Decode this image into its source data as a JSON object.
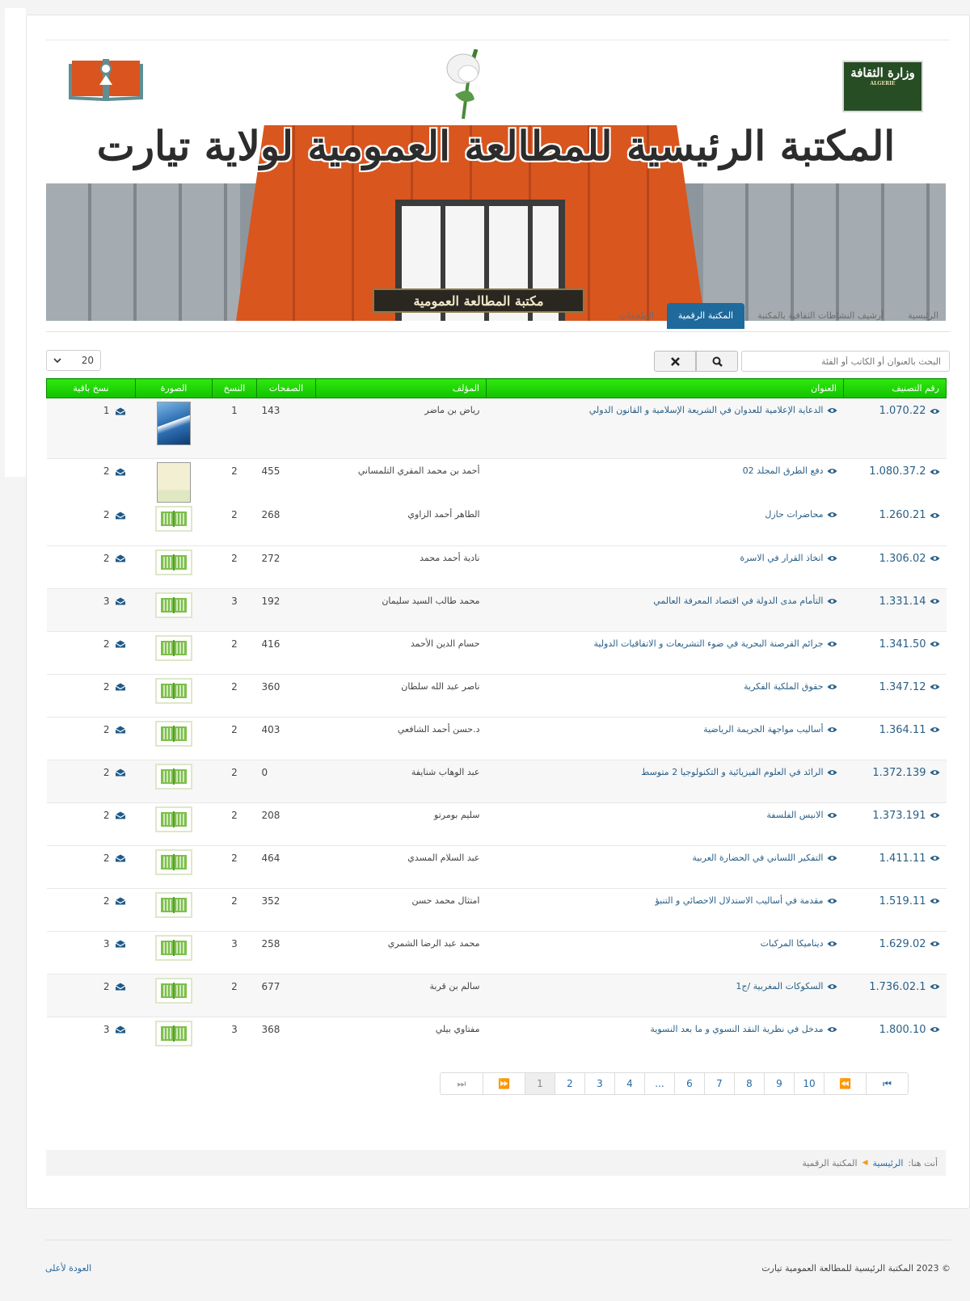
{
  "banner": {
    "title": "المكتبة الرئيسية للمطالعة العمومية لولاية تيارت",
    "sign": "مكتبة المطالعة العمومية",
    "ministry_name": "وزارة الثقافة",
    "ministry_sub": "ALGERIE"
  },
  "nav": {
    "tabs": [
      {
        "label": "الرئيسية",
        "active": false
      },
      {
        "label": "أرشيف النشاطات الثقافية بالمكتبة",
        "active": false
      },
      {
        "label": "المكتبة الرقمية",
        "active": true
      },
      {
        "label": "الملحقات",
        "active": false
      }
    ]
  },
  "search": {
    "placeholder": "البحث بالعنوان أو الكاتب أو الفئة",
    "value": ""
  },
  "page_size": {
    "selected": "20"
  },
  "table": {
    "headers": {
      "code": "رقم التصنيف",
      "title": "العنوان",
      "author": "المؤلف",
      "pages": "الصفحات",
      "copies": "النسخ",
      "image": "الصورة",
      "available": "نسخ باقية"
    },
    "rows": [
      {
        "code": "1.070.22",
        "title": "الدعاية الإعلامية للعدوان في الشريعة الإسلامية و القانون الدولي",
        "author": "رياض بن ماضر",
        "pages": "143",
        "copies": "1",
        "available": "1",
        "thumb": "cover-blue"
      },
      {
        "code": "1.080.37.2",
        "title": "دفع الطرق المجلد 02",
        "author": "أحمد بن محمد المقري التلمساني",
        "pages": "455",
        "copies": "2",
        "available": "2",
        "thumb": "cover-cream"
      },
      {
        "code": "1.260.21",
        "title": "محاضرات حازل",
        "author": "الطاهر أحمد الزاوي",
        "pages": "268",
        "copies": "2",
        "available": "2",
        "thumb": "book"
      },
      {
        "code": "1.306.02",
        "title": "اتخاذ القرار في الاسرة",
        "author": "نادية أحمد محمد",
        "pages": "272",
        "copies": "2",
        "available": "2",
        "thumb": "book"
      },
      {
        "code": "1.331.14",
        "title": "التأمام مدى الدولة في اقتصاد المعرفة العالمي",
        "author": "محمد طالب السيد سليمان",
        "pages": "192",
        "copies": "3",
        "available": "3",
        "thumb": "book"
      },
      {
        "code": "1.341.50",
        "title": "جرائم القرصنة البحرية في ضوء التشريعات و الاتفاقيات الدولية",
        "author": "حسام الدين الأحمد",
        "pages": "416",
        "copies": "2",
        "available": "2",
        "thumb": "book"
      },
      {
        "code": "1.347.12",
        "title": "حقوق الملكية الفكرية",
        "author": "ناصر عبد الله سلطان",
        "pages": "360",
        "copies": "2",
        "available": "2",
        "thumb": "book"
      },
      {
        "code": "1.364.11",
        "title": "أساليب مواجهة الجريمة الرياضية",
        "author": "د.حسن أحمد الشافعي",
        "pages": "403",
        "copies": "2",
        "available": "2",
        "thumb": "book"
      },
      {
        "code": "1.372.139",
        "title": "الرائد في العلوم الفيزيائية و التكنولوجيا 2 متوسط",
        "author": "عبد الوهاب شنايفة",
        "pages": "0",
        "copies": "2",
        "available": "2",
        "thumb": "book"
      },
      {
        "code": "1.373.191",
        "title": "الانيس الفلسفة",
        "author": "سليم بومرتو",
        "pages": "208",
        "copies": "2",
        "available": "2",
        "thumb": "book"
      },
      {
        "code": "1.411.11",
        "title": "التفكير اللساني في الحضارة العربية",
        "author": "عبد السلام المسدي",
        "pages": "464",
        "copies": "2",
        "available": "2",
        "thumb": "book"
      },
      {
        "code": "1.519.11",
        "title": "مقدمة في أساليب الاستدلال الاحصائي و التنبؤ",
        "author": "امتثال محمد حسن",
        "pages": "352",
        "copies": "2",
        "available": "2",
        "thumb": "book"
      },
      {
        "code": "1.629.02",
        "title": "ديناميكا المركبات",
        "author": "محمد عبد الرضا الشمري",
        "pages": "258",
        "copies": "3",
        "available": "3",
        "thumb": "book"
      },
      {
        "code": "1.736.02.1",
        "title": "السكوكات المغربية /ج1",
        "author": "سالم بن قربة",
        "pages": "677",
        "copies": "2",
        "available": "2",
        "thumb": "book"
      },
      {
        "code": "1.800.10",
        "title": "مدخل في نظرية النقد النسوي و ما بعد النسوية",
        "author": "مفتاوي بيلي",
        "pages": "368",
        "copies": "3",
        "available": "3",
        "thumb": "book"
      }
    ]
  },
  "pagination": {
    "items": [
      "⏭",
      "⏩",
      "1",
      "2",
      "3",
      "4",
      "...",
      "6",
      "7",
      "8",
      "9",
      "10",
      "⏪",
      "⏮"
    ],
    "current": "1"
  },
  "breadcrumb": {
    "prefix": "أنت هنا:",
    "items": [
      "الرئيسية",
      "المكتبة الرقمية"
    ]
  },
  "footer": {
    "copyright": "© 2023 المكتبة الرئيسية للمطالعة العمومية تيارت",
    "back_to_top": "العودة لأعلى"
  },
  "colors": {
    "header_green": "#19d400",
    "active_tab": "#1f6a9c",
    "link": "#2a5f86"
  }
}
